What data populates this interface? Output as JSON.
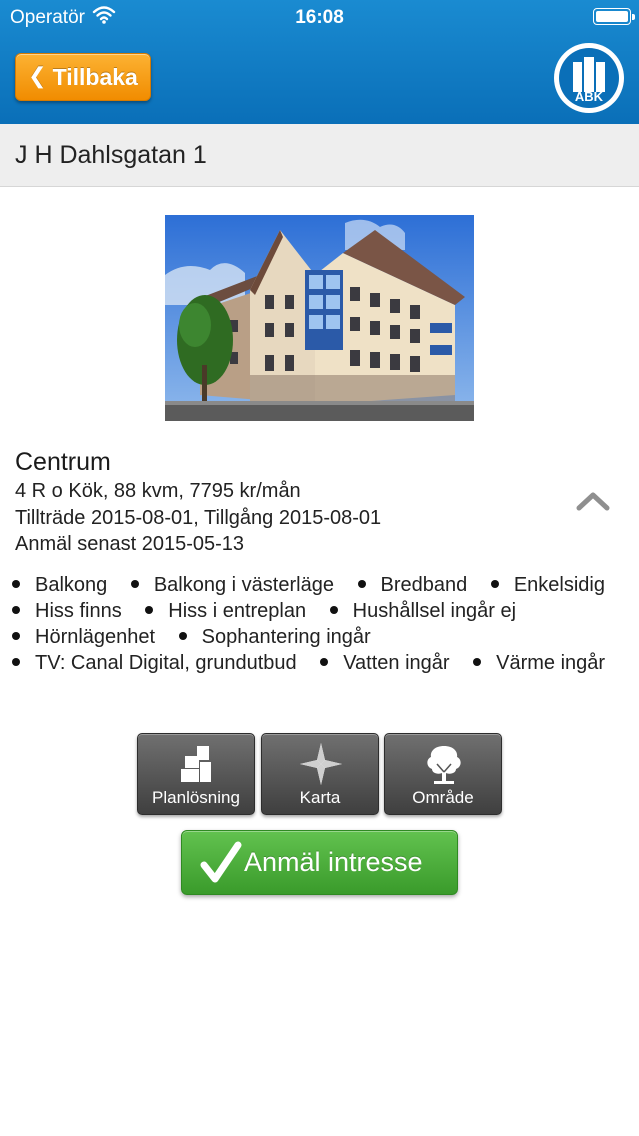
{
  "status_bar": {
    "carrier": "Operatör",
    "time": "16:08",
    "wifi_icon": "wifi-icon",
    "battery_icon": "battery-icon"
  },
  "nav": {
    "back_label": "Tillbaka",
    "back_icon": "chevron-left-icon",
    "logo_text": "ABK"
  },
  "listing": {
    "title": "J H Dahlsgatan 1",
    "area": "Centrum",
    "details": "4 R o Kök, 88 kvm, 7795 kr/mån",
    "access": "Tillträde 2015-08-01, Tillgång 2015-08-01",
    "deadline": "Anmäl senast 2015-05-13",
    "features": [
      "Balkong",
      "Balkong i västerläge",
      "Bredband",
      "Enkelsidig",
      "Hiss finns",
      "Hiss i entreplan",
      "Hushållsel ingår ej",
      "Hörnlägenhet",
      "Sophantering ingår",
      "TV: Canal Digital, grundutbud",
      "Vatten ingår",
      "Värme ingår"
    ]
  },
  "actions": {
    "floorplan_label": "Planlösning",
    "map_label": "Karta",
    "area_label": "Område",
    "register_label": "Anmäl intresse"
  },
  "colors": {
    "header_blue": "#0a6fb8",
    "back_orange": "#f18c00",
    "register_green": "#3a9b2b",
    "tool_gray": "#4a4a4a"
  }
}
